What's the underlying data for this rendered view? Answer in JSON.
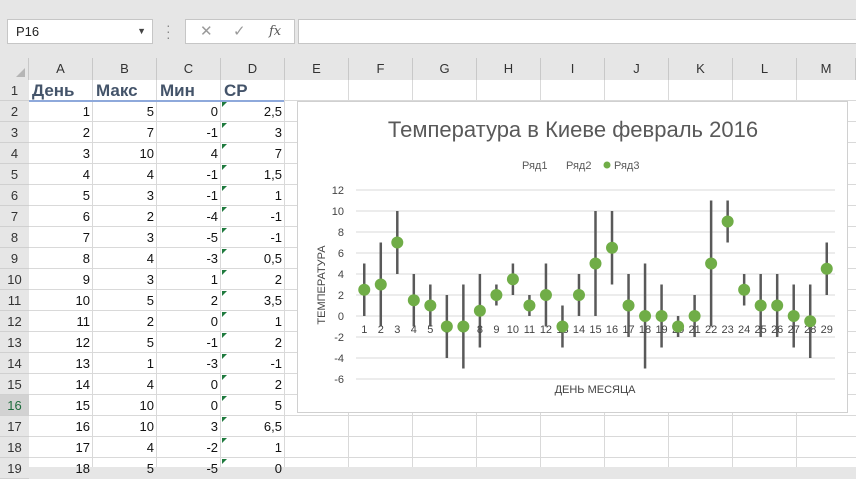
{
  "formula_bar": {
    "name_box": "P16",
    "fx_label": "fx",
    "cancel_icon": "close-icon",
    "enter_icon": "check-icon",
    "formula_value": ""
  },
  "columns": [
    "A",
    "B",
    "C",
    "D",
    "E",
    "F",
    "G",
    "H",
    "I",
    "J",
    "K",
    "L",
    "M"
  ],
  "rows": [
    "1",
    "2",
    "3",
    "4",
    "5",
    "6",
    "7",
    "8",
    "9",
    "10",
    "11",
    "12",
    "13",
    "14",
    "15",
    "16",
    "17",
    "18",
    "19"
  ],
  "selected_row": "16",
  "table": {
    "headers": [
      "День",
      "Макс",
      "Мин",
      "СР"
    ],
    "data": [
      [
        "1",
        "5",
        "0",
        "2,5"
      ],
      [
        "2",
        "7",
        "-1",
        "3"
      ],
      [
        "3",
        "10",
        "4",
        "7"
      ],
      [
        "4",
        "4",
        "-1",
        "1,5"
      ],
      [
        "5",
        "3",
        "-1",
        "1"
      ],
      [
        "6",
        "2",
        "-4",
        "-1"
      ],
      [
        "7",
        "3",
        "-5",
        "-1"
      ],
      [
        "8",
        "4",
        "-3",
        "0,5"
      ],
      [
        "9",
        "3",
        "1",
        "2"
      ],
      [
        "10",
        "5",
        "2",
        "3,5"
      ],
      [
        "11",
        "2",
        "0",
        "1"
      ],
      [
        "12",
        "5",
        "-1",
        "2"
      ],
      [
        "13",
        "1",
        "-3",
        "-1"
      ],
      [
        "14",
        "4",
        "0",
        "2"
      ],
      [
        "15",
        "10",
        "0",
        "5"
      ],
      [
        "16",
        "10",
        "3",
        "6,5"
      ],
      [
        "17",
        "4",
        "-2",
        "1"
      ],
      [
        "18",
        "5",
        "-5",
        "0"
      ]
    ]
  },
  "colors": {
    "bar": "#595959",
    "marker": "#70ad47",
    "title": "#595959",
    "header_text": "#44546a"
  },
  "chart_data": {
    "type": "scatter",
    "title": "Температура в Киеве февраль 2016",
    "xlabel": "ДЕНЬ МЕСЯЦА",
    "ylabel": "ТЕМПЕРАТУРА",
    "legend": [
      "Ряд1",
      "Ряд2",
      "Ряд3"
    ],
    "legend_position": "top",
    "ylim": [
      -6,
      12
    ],
    "yticks": [
      "12",
      "10",
      "8",
      "6",
      "4",
      "2",
      "0",
      "-2",
      "-4",
      "-6"
    ],
    "x": [
      1,
      2,
      3,
      4,
      5,
      6,
      7,
      8,
      9,
      10,
      11,
      12,
      13,
      14,
      15,
      16,
      17,
      18,
      19,
      20,
      21,
      22,
      23,
      24,
      25,
      26,
      27,
      28,
      29
    ],
    "x_labels": [
      "1",
      "2",
      "3",
      "4",
      "5",
      "6",
      "7",
      "8",
      "9",
      "10",
      "11",
      "12",
      "13",
      "14",
      "15",
      "16",
      "17",
      "18",
      "19",
      "20",
      "21",
      "22",
      "23",
      "24",
      "25",
      "26",
      "27",
      "28",
      "29"
    ],
    "series": [
      {
        "name": "Ряд1",
        "values": [
          5,
          7,
          10,
          4,
          3,
          2,
          3,
          4,
          3,
          5,
          2,
          5,
          1,
          4,
          10,
          10,
          4,
          5,
          3,
          0,
          2,
          11,
          11,
          4,
          4,
          4,
          3,
          3,
          7
        ]
      },
      {
        "name": "Ряд2",
        "values": [
          0,
          -1,
          4,
          -1,
          -1,
          -4,
          -5,
          -3,
          1,
          2,
          0,
          -1,
          -3,
          0,
          0,
          3,
          -2,
          -5,
          -3,
          -2,
          -2,
          -1,
          7,
          1,
          -2,
          -2,
          -3,
          -4,
          2
        ]
      },
      {
        "name": "Ряд3",
        "values": [
          2.5,
          3,
          7,
          1.5,
          1,
          -1,
          -1,
          0.5,
          2,
          3.5,
          1,
          2,
          -1,
          2,
          5,
          6.5,
          1,
          0,
          0,
          -1,
          0,
          5,
          9,
          2.5,
          1,
          1,
          0,
          -0.5,
          4.5
        ]
      }
    ]
  }
}
